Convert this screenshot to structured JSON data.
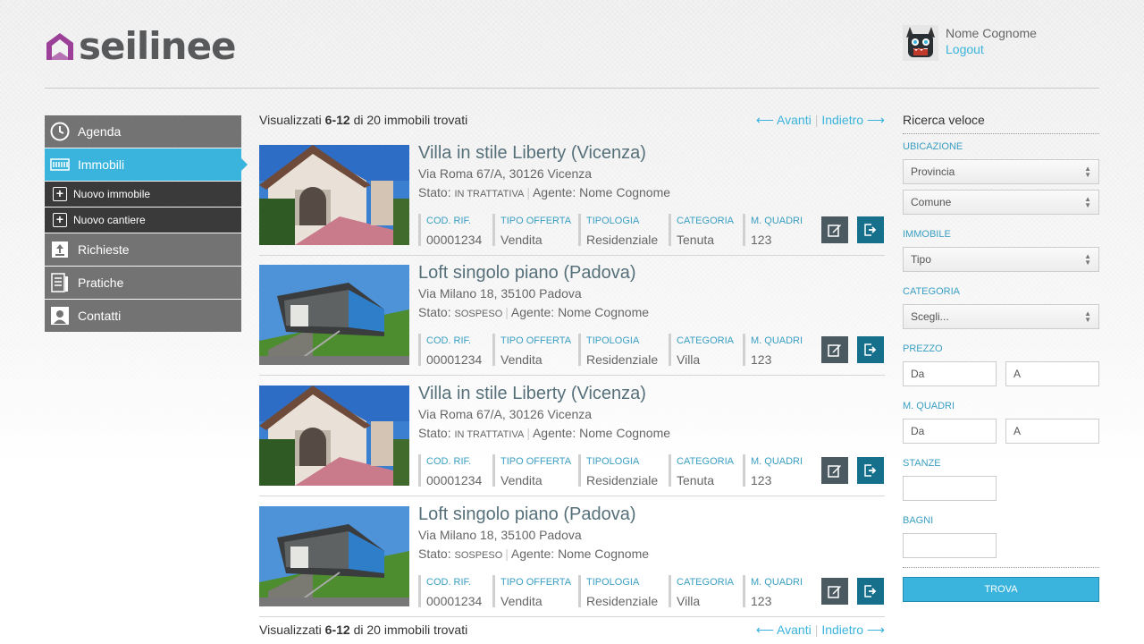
{
  "brand": {
    "name": "seilinee",
    "accent": "#3ab4dd",
    "logo_color": "#9b3f98"
  },
  "user": {
    "name": "Nome Cognome",
    "logout": "Logout",
    "avatar_icon": "monster-avatar-icon"
  },
  "sidebar": {
    "items": [
      {
        "label": "Agenda",
        "icon": "clock-icon"
      },
      {
        "label": "Immobili",
        "icon": "building-icon",
        "active": true
      },
      {
        "label": "Nuovo immobile",
        "icon": "plus-icon",
        "sub": true
      },
      {
        "label": "Nuovo cantiere",
        "icon": "plus-icon",
        "sub": true
      },
      {
        "label": "Richieste",
        "icon": "upload-box-icon"
      },
      {
        "label": "Pratiche",
        "icon": "document-icon"
      },
      {
        "label": "Contatti",
        "icon": "person-icon"
      }
    ]
  },
  "results": {
    "prefix": "Visualizzati",
    "range": "6-12",
    "suffix": "di 20 immobili trovati",
    "next": "⟵ Avanti",
    "prev": "Indietro ⟶"
  },
  "field_labels": {
    "ref": "COD. RIF.",
    "offer": "TIPO OFFERTA",
    "type": "TIPOLOGIA",
    "category": "CATEGORIA",
    "sqm": "M. QUADRI"
  },
  "listings": [
    {
      "title": "Villa in stile Liberty (Vicenza)",
      "address": "Via Roma 67/A, 30126 Vicenza",
      "state_prefix": "Stato:",
      "state": "IN TRATTATIVA",
      "agent": "Agente: Nome Cognome",
      "ref": "00001234",
      "offer": "Vendita",
      "type": "Residenziale",
      "category": "Tenuta",
      "sqm": "123",
      "photo": "villa"
    },
    {
      "title": "Loft singolo piano (Padova)",
      "address": "Via Milano 18, 35100 Padova",
      "state_prefix": "Stato:",
      "state": "SOSPESO",
      "agent": "Agente: Nome Cognome",
      "ref": "00001234",
      "offer": "Vendita",
      "type": "Residenziale",
      "category": "Villa",
      "sqm": "123",
      "photo": "loft"
    },
    {
      "title": "Villa in stile Liberty (Vicenza)",
      "address": "Via Roma 67/A, 30126 Vicenza",
      "state_prefix": "Stato:",
      "state": "IN TRATTATIVA",
      "agent": "Agente: Nome Cognome",
      "ref": "00001234",
      "offer": "Vendita",
      "type": "Residenziale",
      "category": "Tenuta",
      "sqm": "123",
      "photo": "villa"
    },
    {
      "title": "Loft singolo piano (Padova)",
      "address": "Via Milano 18, 35100 Padova",
      "state_prefix": "Stato:",
      "state": "SOSPESO",
      "agent": "Agente: Nome Cognome",
      "ref": "00001234",
      "offer": "Vendita",
      "type": "Residenziale",
      "category": "Villa",
      "sqm": "123",
      "photo": "loft"
    }
  ],
  "search": {
    "title": "Ricerca veloce",
    "ubicazione": "UBICAZIONE",
    "provincia": "Provincia",
    "comune": "Comune",
    "immobile": "IMMOBILE",
    "tipo": "Tipo",
    "categoria": "CATEGORIA",
    "scegli": "Scegli...",
    "prezzo": "PREZZO",
    "da": "Da",
    "a": "A",
    "mquadri": "M. QUADRI",
    "stanze": "STANZE",
    "bagni": "BAGNI",
    "submit": "TROVA"
  }
}
